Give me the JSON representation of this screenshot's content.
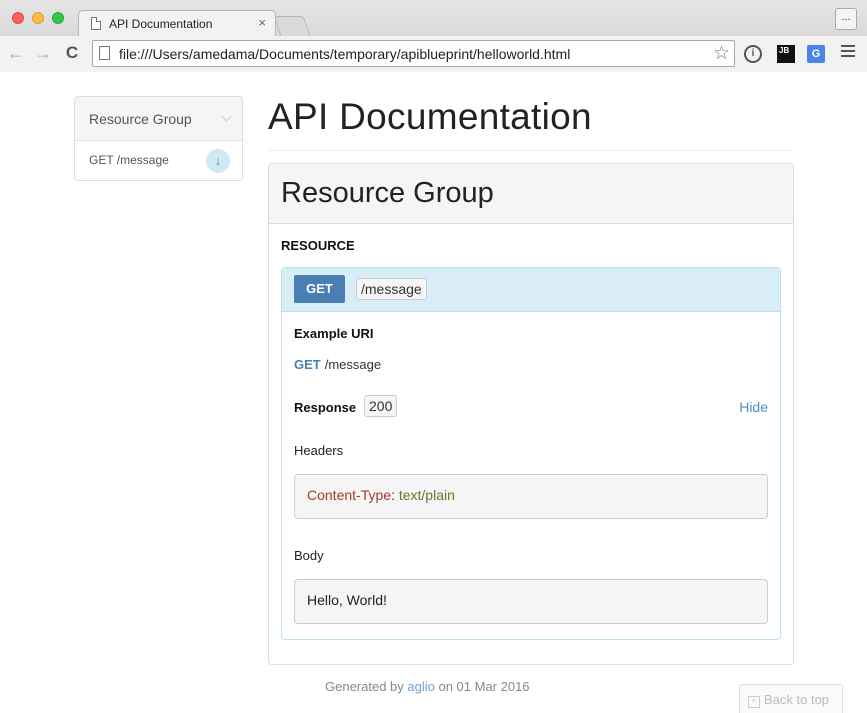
{
  "browser": {
    "tab_title": "API Documentation",
    "tab_close": "×",
    "ext_menu": "...",
    "url": "file:///Users/amedama/Documents/temporary/apiblueprint/helloworld.html",
    "icons": {
      "back": "back-arrow-icon",
      "forward": "forward-arrow-icon",
      "reload": "reload-icon",
      "star": "star-icon",
      "info": "info-icon",
      "jetbrains": "jetbrains-icon",
      "translate": "google-translate-icon",
      "menu": "hamburger-menu-icon"
    },
    "glyphs": {
      "back": "←",
      "forward": "→",
      "reload": "C",
      "star": "☆",
      "info": "i",
      "jb": "JB",
      "translate": "G"
    }
  },
  "nav": {
    "group_label": "Resource Group",
    "items": [
      {
        "label": "GET /message",
        "badge": "↓"
      }
    ]
  },
  "main": {
    "title": "API Documentation",
    "group_title": "Resource Group",
    "resource_label": "RESOURCE",
    "action": {
      "method": "GET",
      "uri": "/message",
      "example_uri_label": "Example URI",
      "example_method": "GET",
      "example_path": "/message",
      "response_label": "Response",
      "status": "200",
      "hide_label": "Hide",
      "headers_label": "Headers",
      "header_key": "Content-Type",
      "header_sep": ": ",
      "header_value": "text/plain",
      "body_label": "Body",
      "body": "Hello, World!"
    }
  },
  "footer": {
    "prefix": "Generated by ",
    "link": "aglio",
    "suffix": " on 01 Mar 2016",
    "back_to_top": "Back to top",
    "back_to_top_glyph": "^"
  },
  "colors": {
    "method_badge": "#4a7fb6",
    "action_header": "#d9edf7",
    "link": "#4a90c9",
    "header_key": "#a33b2c",
    "header_value": "#607a2c"
  }
}
